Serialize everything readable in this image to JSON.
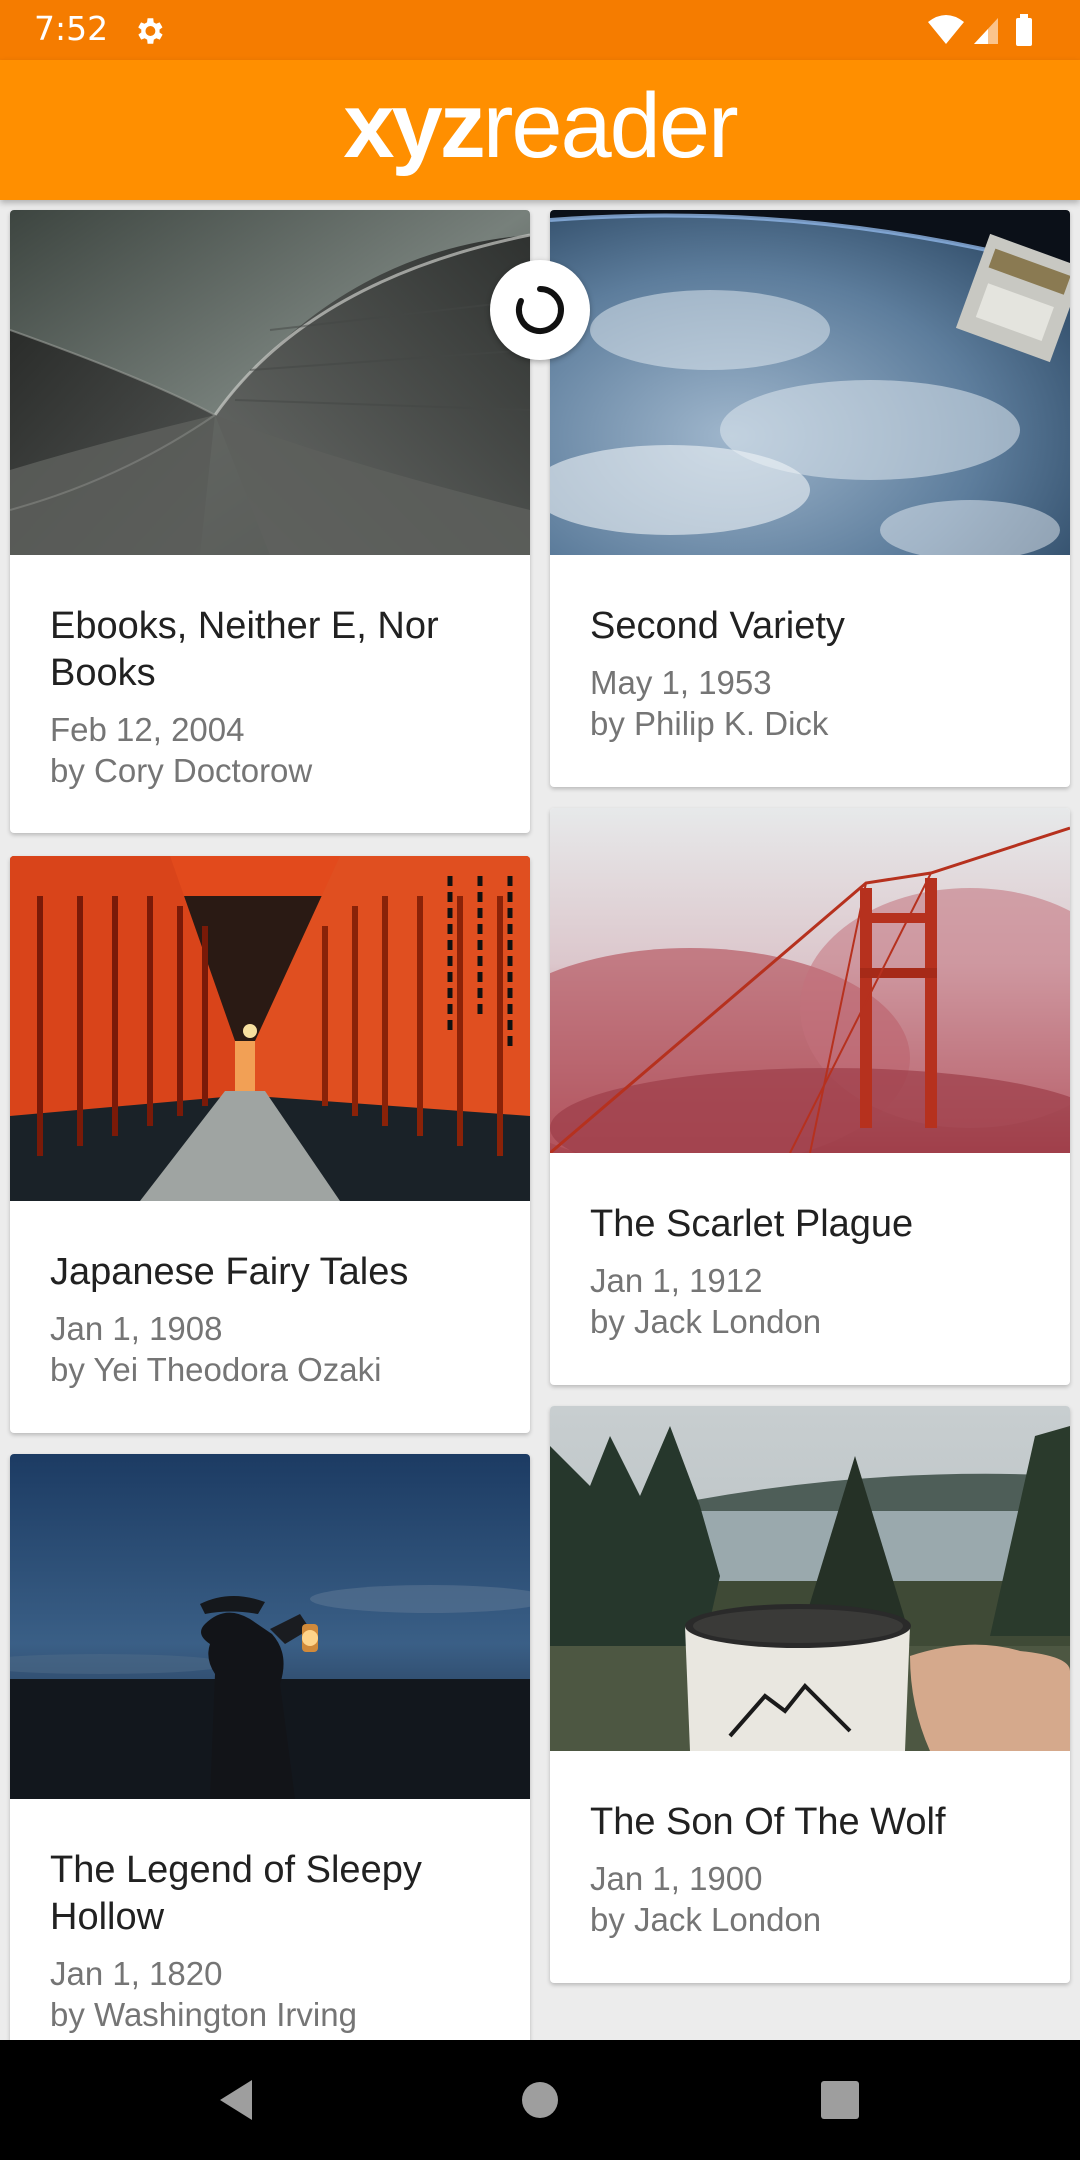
{
  "status_bar": {
    "time": "7:52",
    "icons": [
      "settings-gear-icon",
      "wifi-icon",
      "cellular-signal-icon",
      "battery-icon"
    ]
  },
  "app_bar": {
    "logo_bold": "xyz",
    "logo_regular": "reader"
  },
  "articles": [
    {
      "title": "Ebooks, Neither E, Nor Books",
      "date": "Feb 12, 2004",
      "author": "by Cory Doctorow"
    },
    {
      "title": "Second Variety",
      "date": "May 1, 1953",
      "author": "by Philip K. Dick"
    },
    {
      "title": "Japanese Fairy Tales",
      "date": "Jan 1, 1908",
      "author": "by Yei Theodora Ozaki"
    },
    {
      "title": "The Scarlet Plague",
      "date": "Jan 1, 1912",
      "author": "by Jack London"
    },
    {
      "title": "The Legend of Sleepy Hollow",
      "date": "Jan 1, 1820",
      "author": "by Washington Irving"
    },
    {
      "title": "The Son Of The Wolf",
      "date": "Jan 1, 1900",
      "author": "by Jack London"
    }
  ],
  "nav_bar": {
    "icons": [
      "back-icon",
      "home-icon",
      "recents-icon"
    ]
  },
  "colors": {
    "status_bar": "#f57c00",
    "app_bar": "#ff8f00",
    "background": "#ececec"
  }
}
